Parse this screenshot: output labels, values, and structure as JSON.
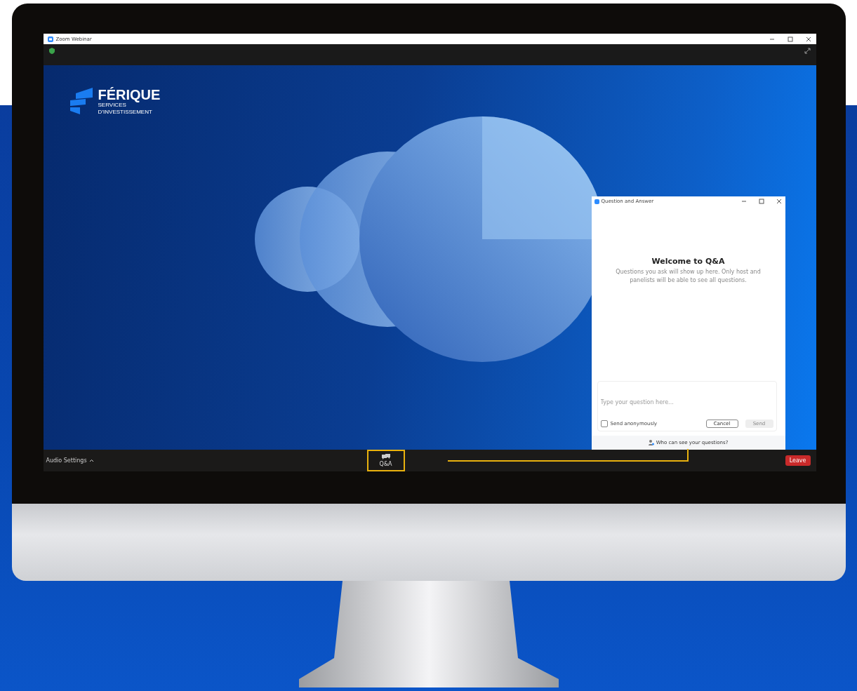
{
  "window": {
    "title": "Zoom Webinar"
  },
  "slide": {
    "brand": "FÉRIQUE",
    "tagline": [
      "SERVICES",
      "D’INVESTISSEMENT"
    ]
  },
  "qa_dialog": {
    "title": "Question and Answer",
    "heading": "Welcome to Q&A",
    "message": "Questions you ask will show up here. Only host and panelists will be able to see all questions.",
    "question_field": {
      "placeholder": "Type your question here..."
    },
    "anonymous": {
      "label": "Send anonymously",
      "checked": false
    },
    "cancel": "Cancel",
    "send": {
      "label": "Send",
      "disabled": true
    },
    "footer_link": "Who can see your questions?"
  },
  "toolbar": {
    "audio_settings": "Audio Settings",
    "qa_button": {
      "label": "Q&A",
      "highlighted": true
    },
    "leave": "Leave"
  }
}
